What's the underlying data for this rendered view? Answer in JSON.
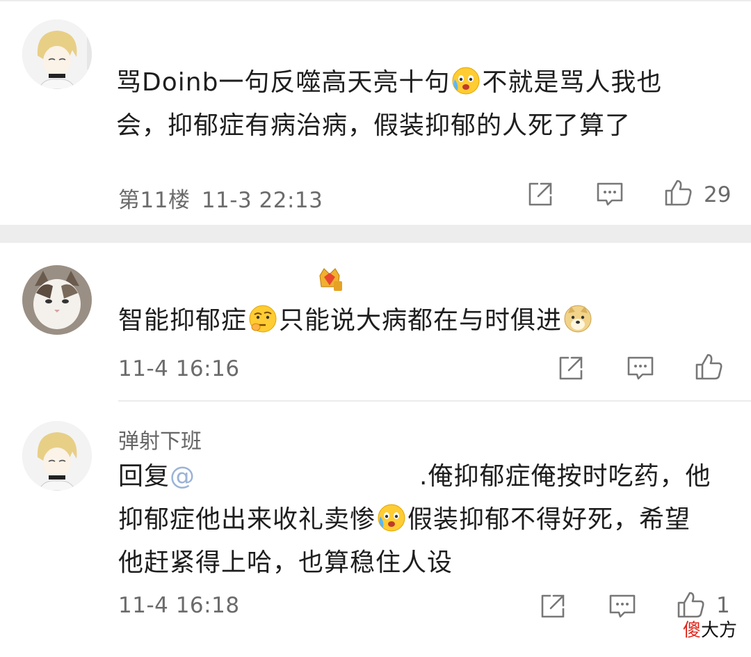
{
  "comments": [
    {
      "username": "",
      "text_line1_a": "骂Doinb一句反噬高天亮十句",
      "text_line1_b": "不就是骂人我也",
      "text_line2": "会，抑郁症有病治病，假装抑郁的人死了算了",
      "floor": "第11楼",
      "time": "11-3 22:13",
      "likes": "29"
    },
    {
      "username": "",
      "text_a": "智能抑郁症",
      "text_b": "只能说大病都在与时俱进",
      "time": "11-4 16:16",
      "likes": ""
    },
    {
      "username": "弹射下班",
      "reply_prefix": "回复",
      "reply_mention_start": "@",
      "reply_line1_rest": ".俺抑郁症俺按时吃药，他",
      "reply_line2_a": "抑郁症他出来收礼卖惨",
      "reply_line2_b": "假装抑郁不得好死，希望",
      "reply_line3": "他赶紧得上哈，也算稳住人设",
      "time": "11-4 16:18",
      "likes": "1"
    }
  ],
  "icons": [
    "share-icon",
    "comment-icon",
    "like-thumb-icon"
  ],
  "watermark": {
    "red": "傻",
    "black": "大方"
  },
  "colors": {
    "gap": "#ededed",
    "meta": "#6b6b6b",
    "text": "#1e1e1e",
    "watermark_red": "#e0261a"
  }
}
